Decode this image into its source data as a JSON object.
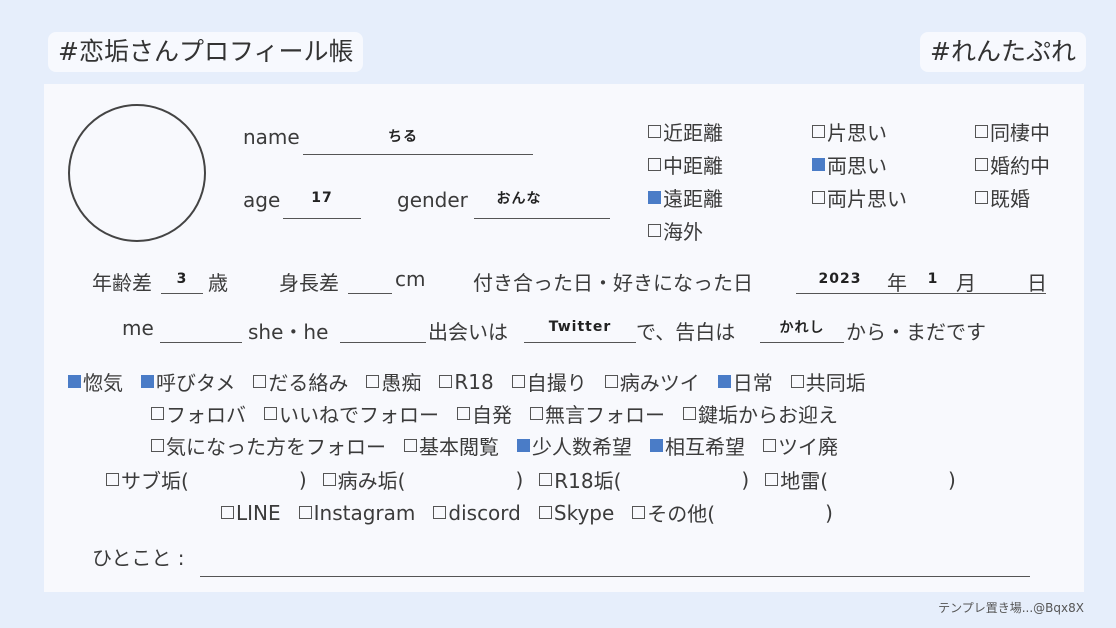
{
  "header": {
    "left_title": "#恋垢さんプロフィール帳",
    "right_title": "#れんたぷれ"
  },
  "profile": {
    "name_label": "name",
    "name_value": "ちる",
    "age_label": "age",
    "age_value": "17",
    "gender_label": "gender",
    "gender_value": "おんな"
  },
  "relationship_options": [
    {
      "label": "近距離",
      "checked": false
    },
    {
      "label": "片思い",
      "checked": false
    },
    {
      "label": "同棲中",
      "checked": false
    },
    {
      "label": "中距離",
      "checked": false
    },
    {
      "label": "両思い",
      "checked": true
    },
    {
      "label": "婚約中",
      "checked": false
    },
    {
      "label": "遠距離",
      "checked": true
    },
    {
      "label": "両片思い",
      "checked": false
    },
    {
      "label": "既婚",
      "checked": false
    },
    {
      "label": "海外",
      "checked": false
    }
  ],
  "row_details": {
    "age_gap_label": "年齢差",
    "age_gap_value": "3",
    "age_gap_unit": "歳",
    "height_gap_label": "身長差",
    "height_gap_unit": "cm",
    "date_label": "付き合った日・好きになった日",
    "date_year": "2023",
    "year_unit": "年",
    "date_month": "1",
    "month_unit": "月",
    "day_unit": "日"
  },
  "row_meet": {
    "me_label": "me",
    "she_he_label": "she・he",
    "met_label": "出会いは",
    "met_value": "Twitter",
    "confession_label": "で、告白は",
    "confession_value": "かれし",
    "from_label": "から・まだです"
  },
  "tags_row1": [
    {
      "label": "惚気",
      "checked": true
    },
    {
      "label": "呼びタメ",
      "checked": true
    },
    {
      "label": "だる絡み",
      "checked": false
    },
    {
      "label": "愚痴",
      "checked": false
    },
    {
      "label": " R18",
      "checked": false
    },
    {
      "label": "自撮り",
      "checked": false
    },
    {
      "label": "病みツイ",
      "checked": false
    },
    {
      "label": "日常",
      "checked": true
    },
    {
      "label": "共同垢",
      "checked": false
    }
  ],
  "tags_row2": [
    {
      "label": "フォロバ",
      "checked": false
    },
    {
      "label": "いいねでフォロー",
      "checked": false
    },
    {
      "label": "自発",
      "checked": false
    },
    {
      "label": "無言フォロー",
      "checked": false
    },
    {
      "label": "鍵垢からお迎え",
      "checked": false
    }
  ],
  "tags_row3": [
    {
      "label": "気になった方をフォロー",
      "checked": false
    },
    {
      "label": "基本閲覧",
      "checked": false
    },
    {
      "label": "少人数希望",
      "checked": true
    },
    {
      "label": "相互希望",
      "checked": true
    },
    {
      "label": "ツイ廃",
      "checked": false
    }
  ],
  "tags_row4": [
    {
      "label": "サブ垢(",
      "close": ")",
      "checked": false
    },
    {
      "label": "病み垢(",
      "close": ")",
      "checked": false
    },
    {
      "label": "R18垢(",
      "close": ")",
      "checked": false
    },
    {
      "label": "地雷(",
      "close": ")",
      "checked": false
    }
  ],
  "tags_row5": [
    {
      "label": "LINE",
      "checked": false
    },
    {
      "label": "Instagram",
      "checked": false
    },
    {
      "label": "discord",
      "checked": false
    },
    {
      "label": "Skype",
      "checked": false
    },
    {
      "label": "その他(",
      "close": ")",
      "checked": false
    }
  ],
  "comment": {
    "label": "ひとこと :"
  },
  "footer": {
    "credit": "テンプレ置き場...@Bqx8X"
  }
}
